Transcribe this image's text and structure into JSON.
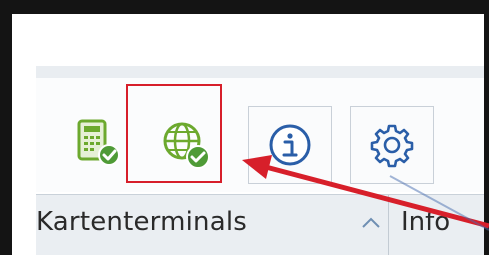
{
  "toolbar": {
    "buttons": [
      {
        "icon": "card-terminal-icon"
      },
      {
        "icon": "network-check-icon"
      },
      {
        "icon": "info-icon"
      },
      {
        "icon": "gear-icon"
      }
    ]
  },
  "panel": {
    "title": "Kartenterminals",
    "side_tab": "Info"
  },
  "colors": {
    "accent_green": "#6ca92e",
    "check_green": "#4f9b37",
    "info_blue": "#2a5ea8",
    "highlight_red": "#d71f2a"
  }
}
